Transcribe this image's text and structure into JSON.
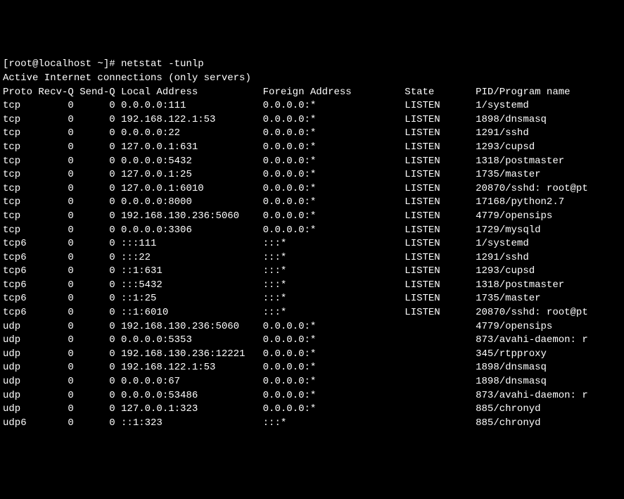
{
  "prompt": "[root@localhost ~]# netstat -tunlp",
  "header": "Active Internet connections (only servers)",
  "columns": "Proto Recv-Q Send-Q Local Address           Foreign Address         State       PID/Program name",
  "rows": [
    {
      "text": "tcp        0      0 0.0.0.0:111             0.0.0.0:*               LISTEN      1/systemd"
    },
    {
      "text": "tcp        0      0 192.168.122.1:53        0.0.0.0:*               LISTEN      1898/dnsmasq"
    },
    {
      "text": "tcp        0      0 0.0.0.0:22              0.0.0.0:*               LISTEN      1291/sshd"
    },
    {
      "text": "tcp        0      0 127.0.0.1:631           0.0.0.0:*               LISTEN      1293/cupsd"
    },
    {
      "text": "tcp        0      0 0.0.0.0:5432            0.0.0.0:*               LISTEN      1318/postmaster"
    },
    {
      "text": "tcp        0      0 127.0.0.1:25            0.0.0.0:*               LISTEN      1735/master"
    },
    {
      "text": "tcp        0      0 127.0.0.1:6010          0.0.0.0:*               LISTEN      20870/sshd: root@pt"
    },
    {
      "text": "tcp        0      0 0.0.0.0:8000            0.0.0.0:*               LISTEN      17168/python2.7"
    },
    {
      "text": "tcp        0      0 192.168.130.236:5060    0.0.0.0:*               LISTEN      4779/opensips"
    },
    {
      "text": "tcp        0      0 0.0.0.0:3306            0.0.0.0:*               LISTEN      1729/mysqld"
    },
    {
      "text": "tcp6       0      0 :::111                  :::*                    LISTEN      1/systemd"
    },
    {
      "text": "tcp6       0      0 :::22                   :::*                    LISTEN      1291/sshd"
    },
    {
      "text": "tcp6       0      0 ::1:631                 :::*                    LISTEN      1293/cupsd"
    },
    {
      "text": "tcp6       0      0 :::5432                 :::*                    LISTEN      1318/postmaster"
    },
    {
      "text": "tcp6       0      0 ::1:25                  :::*                    LISTEN      1735/master"
    },
    {
      "text": "tcp6       0      0 ::1:6010                :::*                    LISTEN      20870/sshd: root@pt"
    },
    {
      "text": "udp        0      0 192.168.130.236:5060    0.0.0.0:*                           4779/opensips"
    },
    {
      "text": "udp        0      0 0.0.0.0:5353            0.0.0.0:*                           873/avahi-daemon: r"
    },
    {
      "text": "udp        0      0 192.168.130.236:12221   0.0.0.0:*                           345/rtpproxy"
    },
    {
      "text": "udp        0      0 192.168.122.1:53        0.0.0.0:*                           1898/dnsmasq"
    },
    {
      "text": "udp        0      0 0.0.0.0:67              0.0.0.0:*                           1898/dnsmasq"
    },
    {
      "text": "udp        0      0 0.0.0.0:53486           0.0.0.0:*                           873/avahi-daemon: r"
    },
    {
      "text": "udp        0      0 127.0.0.1:323           0.0.0.0:*                           885/chronyd"
    },
    {
      "text": "udp6       0      0 ::1:323                 :::*                                885/chronyd"
    }
  ]
}
